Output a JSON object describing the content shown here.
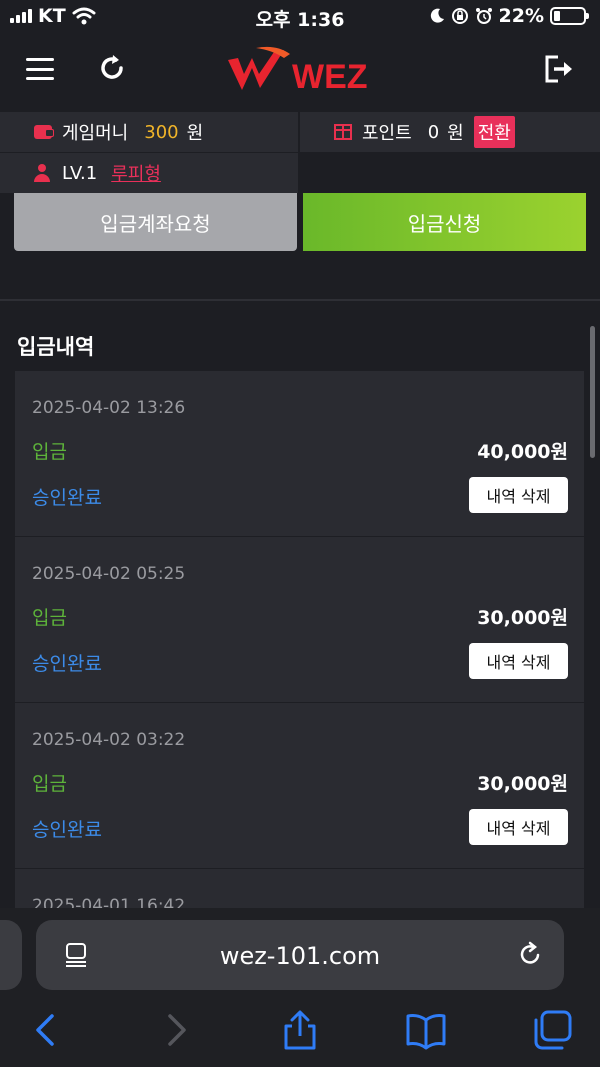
{
  "status_bar": {
    "carrier": "KT",
    "time": "오후 1:36",
    "battery": "22%",
    "battery_level": 0.22
  },
  "header": {
    "logo_text": "WEZ",
    "icons": [
      "hamburger-menu-icon",
      "refresh-icon",
      "logout-icon"
    ]
  },
  "user_info": {
    "game_money_label": "게임머니",
    "game_money_value": "300",
    "game_money_unit": "원",
    "point_label": "포인트",
    "point_value": "0",
    "point_unit": "원",
    "convert_label": "전환",
    "level": "LV.1",
    "level_name": "루피형"
  },
  "actions": {
    "account_request": "입금계좌요청",
    "deposit_request": "입금신청"
  },
  "history": {
    "title": "입금내역",
    "items": [
      {
        "date": "2025-04-02 13:26",
        "type": "입금",
        "amount": "40,000원",
        "status": "승인완료",
        "delete_label": "내역 삭제"
      },
      {
        "date": "2025-04-02 05:25",
        "type": "입금",
        "amount": "30,000원",
        "status": "승인완료",
        "delete_label": "내역 삭제"
      },
      {
        "date": "2025-04-02 03:22",
        "type": "입금",
        "amount": "30,000원",
        "status": "승인완료",
        "delete_label": "내역 삭제"
      },
      {
        "date": "2025-04-01 16:42",
        "type": "",
        "amount": "",
        "status": "",
        "delete_label": ""
      }
    ]
  },
  "browser": {
    "url": "wez-101.com"
  },
  "colors": {
    "background": "#1d1e23",
    "panel": "#2a2b31",
    "accent_red": "#e8305a",
    "gold": "#f0b429",
    "green": "#5db33a",
    "blue": "#3c8be8",
    "ios_blue": "#2f7cf6"
  }
}
